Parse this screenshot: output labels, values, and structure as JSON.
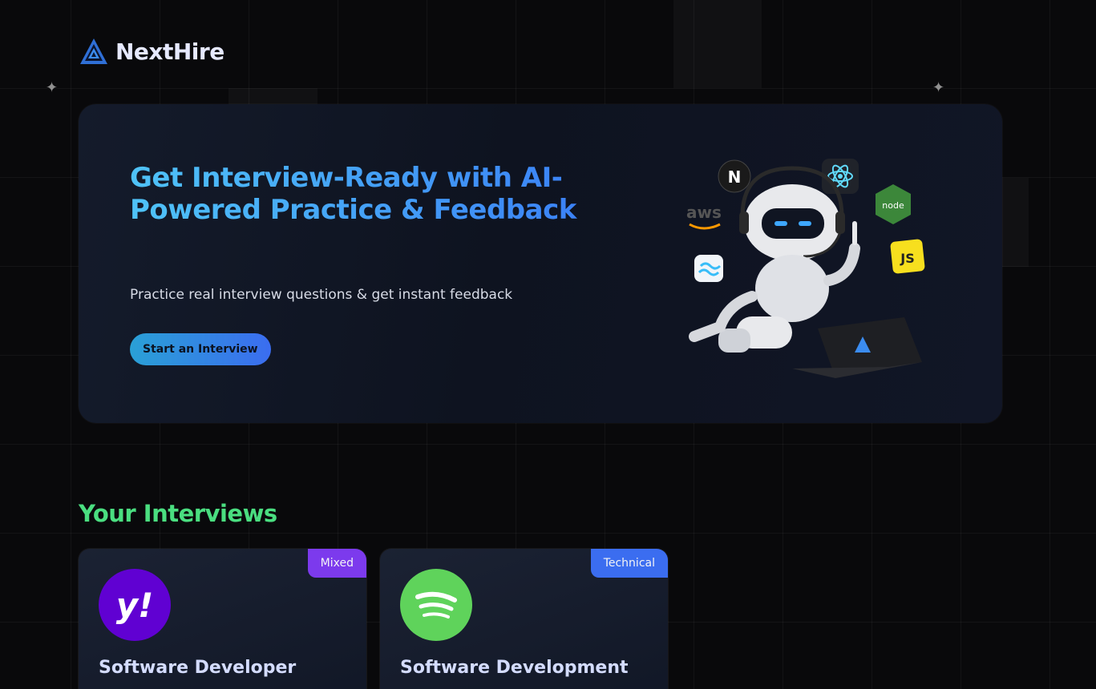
{
  "brand": {
    "name": "NextHire"
  },
  "hero": {
    "title": "Get Interview-Ready with AI-Powered Practice & Feedback",
    "subtitle": "Practice real interview questions & get instant feedback",
    "cta_label": "Start an Interview"
  },
  "tech_icons": [
    "nextjs-icon",
    "react-icon",
    "nodejs-icon",
    "aws-icon",
    "tailwind-icon",
    "javascript-icon"
  ],
  "tech_labels": {
    "aws": "aws",
    "node": "node",
    "js": "JS",
    "next": "N"
  },
  "interviews_section": {
    "title": "Your Interviews"
  },
  "interviews": [
    {
      "role": "Software Developer",
      "type": "Mixed",
      "company_icon": "yahoo-icon",
      "company_mark": "y!",
      "badge_color": "#7c3aed",
      "logo_color": "#6001d2"
    },
    {
      "role": "Software Development",
      "type": "Technical",
      "company_icon": "spotify-icon",
      "badge_color": "#3b6df0",
      "logo_color": "#1ed760"
    }
  ],
  "colors": {
    "accent_green": "#4ade80",
    "accent_blue": "#3b82f6",
    "background": "#09090b"
  }
}
